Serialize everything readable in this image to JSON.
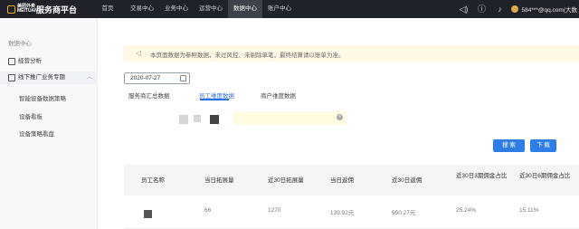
{
  "topbar": {
    "logo_text": "美团外卖 MEITUAN",
    "brand": "服务商平台",
    "nav": [
      "首页",
      "交易中心",
      "业务中心",
      "运营中心",
      "数据中心",
      "账户中心"
    ],
    "active_nav": "数据中心",
    "user": "584***@qq.com(大数"
  },
  "sidebar": {
    "header": "数据中心",
    "items": [
      {
        "label": "经营分析"
      },
      {
        "label": "线下推广业务专题"
      }
    ],
    "subitems": [
      "智能设备数据策略",
      "设备看板",
      "设备策略看盘"
    ]
  },
  "notice": {
    "text": "本页面数据为参照数据，未过风控、未剔除单笔，最终结算请以账单为准。"
  },
  "filter": {
    "date": "2020-07-27"
  },
  "tabs": [
    "服务商汇总数据",
    "员工维度数据",
    "商户维度数据"
  ],
  "actions": {
    "search": "搜 索",
    "download": "下 载"
  },
  "table": {
    "columns": [
      "员工名称",
      "当日拓展量",
      "近30日拓展量",
      "当日返佣",
      "近30日返佣",
      "近30日3期佣金占比",
      "近30日6期佣金占比"
    ],
    "rows": [
      [
        "",
        "66",
        "1270",
        "139.92元",
        "950.27元",
        "25.24%",
        "15.11%"
      ]
    ]
  }
}
